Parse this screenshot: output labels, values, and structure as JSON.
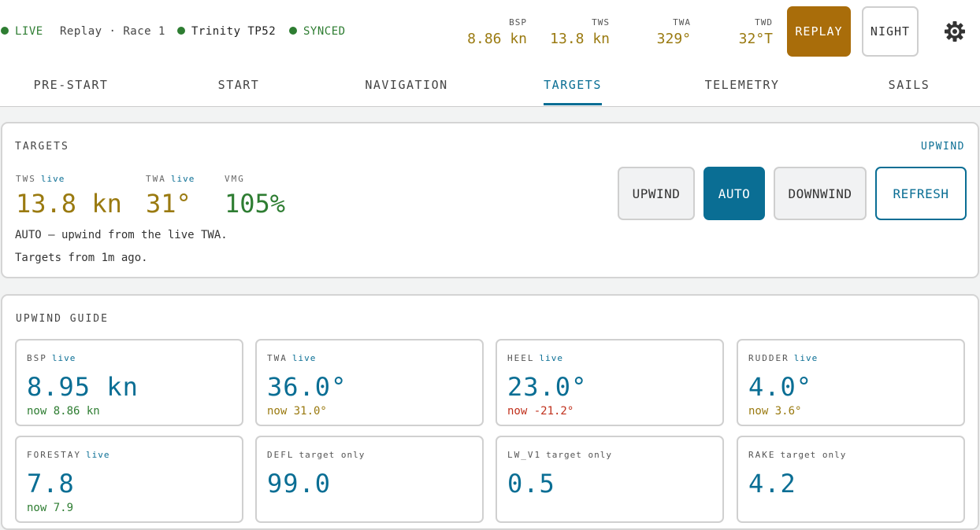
{
  "header": {
    "live_label": "LIVE",
    "session": "Replay · Race 1",
    "boat": "Trinity TP52",
    "sync": "SYNCED",
    "metrics": [
      {
        "label": "BSP",
        "value": "8.86 kn"
      },
      {
        "label": "TWS",
        "value": "13.8 kn"
      },
      {
        "label": "TWA",
        "value": "329°"
      },
      {
        "label": "TWD",
        "value": "32°T"
      }
    ],
    "replay_label": "REPLAY",
    "night_label": "NIGHT",
    "settings_icon": "gear-icon",
    "colors": {
      "live": "#2e7d32",
      "value": "#9a7a10",
      "replay": "#a96d0a"
    }
  },
  "tabs": [
    {
      "label": "PRE-START"
    },
    {
      "label": "START"
    },
    {
      "label": "NAVIGATION"
    },
    {
      "label": "TARGETS",
      "active": true
    },
    {
      "label": "TELEMETRY"
    },
    {
      "label": "SAILS"
    }
  ],
  "targets": {
    "title": "TARGETS",
    "mode": "UPWIND",
    "tws": {
      "label": "TWS",
      "tag": "live",
      "value": "13.8 kn"
    },
    "twa": {
      "label": "TWA",
      "tag": "live",
      "value": "31°"
    },
    "vmg": {
      "label": "VMG",
      "value": "105%"
    },
    "note1": "AUTO — upwind from the live TWA.",
    "note2": "Targets from 1m ago.",
    "buttons": {
      "upwind": "UPWIND",
      "auto": "AUTO",
      "downwind": "DOWNWIND",
      "refresh": "REFRESH"
    },
    "accent": "#0a6e94"
  },
  "guide": {
    "title": "UPWIND GUIDE",
    "tiles": [
      {
        "label": "BSP",
        "tag": "live",
        "value": "8.95 kn",
        "now": "now 8.86 kn",
        "now_color": "green"
      },
      {
        "label": "TWA",
        "tag": "live",
        "value": "36.0°",
        "now": "now 31.0°",
        "now_color": "gold"
      },
      {
        "label": "HEEL",
        "tag": "live",
        "value": "23.0°",
        "now": "now -21.2°",
        "now_color": "red"
      },
      {
        "label": "RUDDER",
        "tag": "live",
        "value": "4.0°",
        "now": "now 3.6°",
        "now_color": "gold"
      },
      {
        "label": "FORESTAY",
        "tag": "live",
        "value": "7.8",
        "now": "now 7.9",
        "now_color": "green"
      },
      {
        "label": "DEFL",
        "tag": "target only",
        "value": "99.0"
      },
      {
        "label": "LW_V1",
        "tag": "target only",
        "value": "0.5"
      },
      {
        "label": "RAKE",
        "tag": "target only",
        "value": "4.2"
      }
    ]
  }
}
